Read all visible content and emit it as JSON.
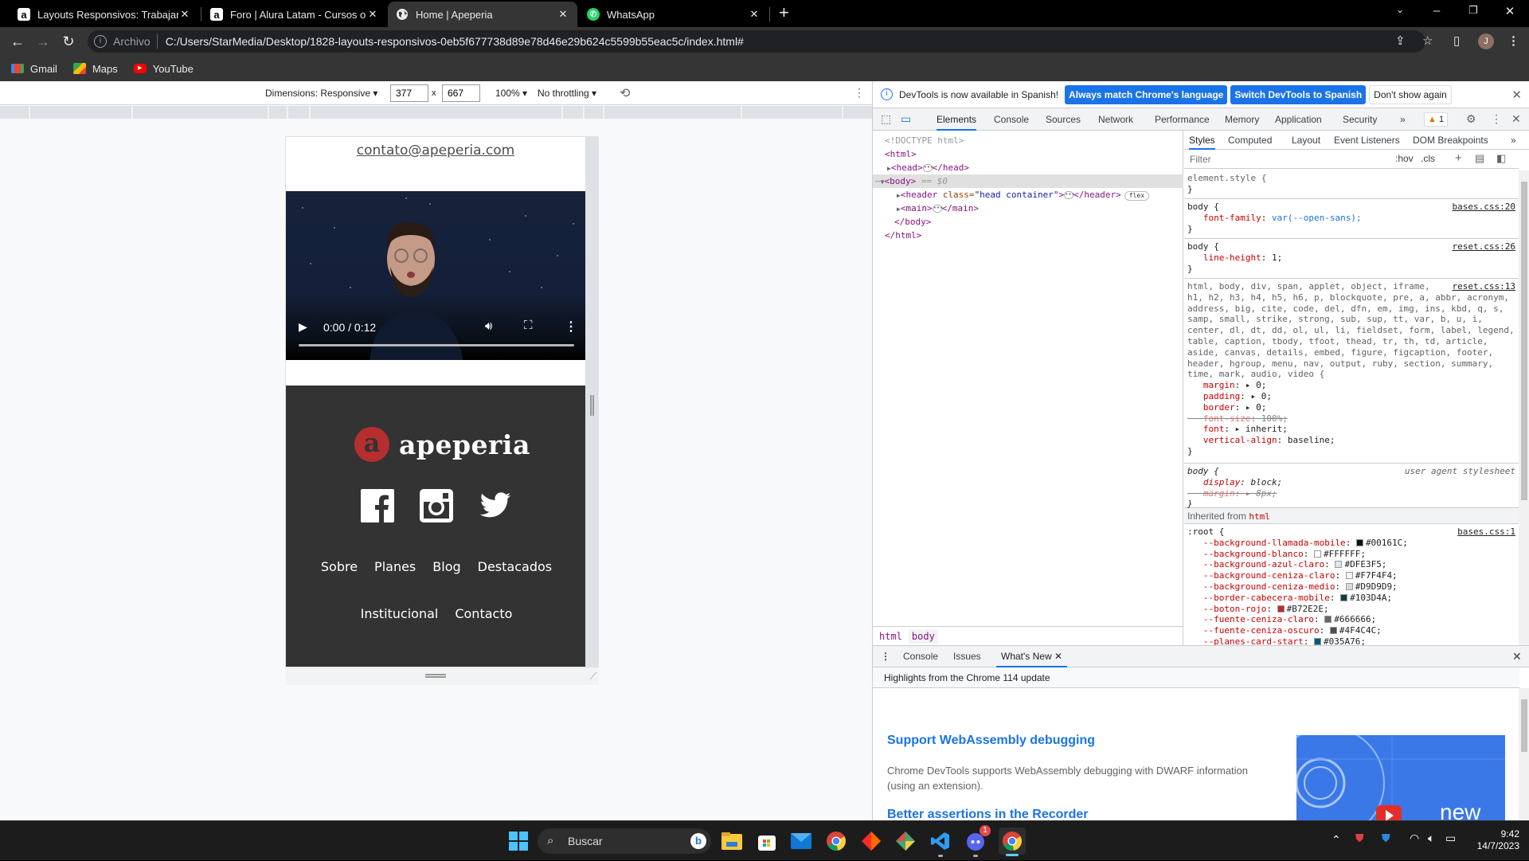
{
  "browser": {
    "tabs": [
      {
        "title": "Layouts Responsivos: Trabajando",
        "favicon": "alura-icon",
        "active": false
      },
      {
        "title": "Foro | Alura Latam - Cursos online",
        "favicon": "alura-icon",
        "active": false
      },
      {
        "title": "Home | Apeperia",
        "favicon": "globe-icon",
        "active": true
      },
      {
        "title": "WhatsApp",
        "favicon": "whatsapp-icon",
        "active": false
      }
    ],
    "close_glyph": "✕",
    "new_tab_glyph": "+",
    "address": {
      "scheme_label": "Archivo",
      "url": "C:/Users/StarMedia/Desktop/1828-layouts-responsivos-0eb5f677738d89e78d46e29b624c5599b55eac5c/index.html#"
    },
    "profile_initial": "J",
    "bookmarks": [
      {
        "label": "Gmail",
        "icon": "gmail-icon"
      },
      {
        "label": "Maps",
        "icon": "maps-icon"
      },
      {
        "label": "YouTube",
        "icon": "youtube-icon"
      }
    ]
  },
  "device_toolbar": {
    "dimensions_label": "Dimensions: Responsive ▾",
    "width": "377",
    "height": "667",
    "times": "x",
    "zoom": "100% ▾",
    "throttling": "No throttling ▾"
  },
  "page": {
    "email": "contato@apeperia.com",
    "video": {
      "time": "0:00 / 0:12",
      "progress": 0
    },
    "logo": {
      "mark": "a",
      "name": "apeperia"
    },
    "socials": [
      "facebook",
      "instagram",
      "twitter"
    ],
    "nav_row1": [
      "Sobre",
      "Planes",
      "Blog",
      "Destacados"
    ],
    "nav_row2": [
      "Institucional",
      "Contacto"
    ]
  },
  "devtools": {
    "infobar": {
      "message": "DevTools is now available in Spanish!",
      "btn_match": "Always match Chrome's language",
      "btn_switch": "Switch DevTools to Spanish",
      "btn_dismiss": "Don't show again"
    },
    "tabs": [
      "Elements",
      "Console",
      "Sources",
      "Network",
      "Performance",
      "Memory",
      "Application",
      "Security"
    ],
    "more_tabs": "»",
    "warning_count": "1",
    "dom": {
      "doctype": "<!DOCTYPE html>",
      "html_open": "<html>",
      "head": "<head>",
      "head_close": "</head>",
      "body": "<body>",
      "body_marker": "== $0",
      "header_tag": "<header ",
      "header_attr": "class=",
      "header_val": "\"head container\"",
      "header_close": "</header>",
      "flex_badge": "flex",
      "main": "<main>",
      "main_close": "</main>",
      "body_close": "</body>",
      "html_close": "</html>"
    },
    "breadcrumbs": [
      "html",
      "body"
    ],
    "styles_tabs": [
      "Styles",
      "Computed",
      "Layout",
      "Event Listeners",
      "DOM Breakpoints"
    ],
    "filter_placeholder": "Filter",
    "filter_tools": ":hov .cls",
    "rules": {
      "element_style": "element.style {",
      "close": "}",
      "body_selector": "body {",
      "r1_source": "bases.css:20",
      "r1_prop": "font-family",
      "r1_value": "var(--open-sans);",
      "r2_source": "reset.css:26",
      "r2_prop": "line-height",
      "r2_value": "1;",
      "r3_source": "reset.css:13",
      "r3_selector_lines": [
        "html, body, div, span, applet, object, iframe,",
        "h1, h2, h3, h4, h5, h6, p, blockquote, pre, a, abbr, acronym,",
        "address, big, cite, code, del, dfn, em, img, ins, kbd, q, s,",
        "samp, small, strike, strong, sub, sup, tt, var, b, u, i,",
        "center, dl, dt, dd, ol, ul, li, fieldset, form, label, legend,",
        "table, caption, tbody, tfoot, thead, tr, th, td, article,",
        "aside, canvas, details, embed, figure, figcaption, footer,",
        "header, hgroup, menu, nav, output, ruby, section, summary,",
        "time, mark, audio, video {"
      ],
      "r3_decls": [
        {
          "prop": "margin",
          "value": "▸ 0;",
          "struck": false
        },
        {
          "prop": "padding",
          "value": "▸ 0;",
          "struck": false
        },
        {
          "prop": "border",
          "value": "▸ 0;",
          "struck": false
        },
        {
          "prop": "font-size",
          "value": "100%;",
          "struck": true
        },
        {
          "prop": "font",
          "value": "▸ inherit;",
          "struck": false
        },
        {
          "prop": "vertical-align",
          "value": "baseline;",
          "struck": false
        }
      ],
      "ua_source": "user agent stylesheet",
      "ua_decls": [
        {
          "prop": "display",
          "value": "block;",
          "struck": false
        },
        {
          "prop": "margin",
          "value": "▸ 8px;",
          "struck": true
        }
      ],
      "inherited_label": "Inherited from",
      "inherited_tag": "html",
      "root_selector": ":root {",
      "root_source": "bases.css:1",
      "root_vars": [
        {
          "name": "--background-llamada-mobile",
          "value": "#00161C"
        },
        {
          "name": "--background-blanco",
          "value": "#FFFFFF"
        },
        {
          "name": "--background-azul-claro",
          "value": "#DFE3F5"
        },
        {
          "name": "--background-ceniza-claro",
          "value": "#F7F4F4"
        },
        {
          "name": "--background-ceniza-medio",
          "value": "#D9D9D9"
        },
        {
          "name": "--border-cabecera-mobile",
          "value": "#103D4A"
        },
        {
          "name": "--boton-rojo",
          "value": "#B72E2E"
        },
        {
          "name": "--fuente-ceniza-claro",
          "value": "#666666"
        },
        {
          "name": "--fuente-ceniza-oscuro",
          "value": "#4F4C4C"
        },
        {
          "name": "--planes-card-start",
          "value": "#035A76"
        }
      ]
    },
    "drawer": {
      "tabs": [
        "Console",
        "Issues",
        "What's New"
      ],
      "subtitle": "Highlights from the Chrome 114 update",
      "h1": "Support WebAssembly debugging",
      "p1": "Chrome DevTools supports WebAssembly debugging with DWARF information (using an extension).",
      "h2": "Better assertions in the Recorder",
      "thumb_label": "new"
    }
  },
  "taskbar": {
    "search_placeholder": "Buscar",
    "apps": [
      "file-explorer",
      "microsoft-store",
      "mail",
      "chrome",
      "app-red-diamond",
      "git-kraken",
      "vscode",
      "discord",
      "chrome-active"
    ],
    "discord_badge": "1",
    "time": "9:42",
    "date": "14/7/2023"
  },
  "colors": {
    "accent_blue": "#1a73e8",
    "brand_red": "#B72E2E",
    "footer_bg": "#333333"
  }
}
